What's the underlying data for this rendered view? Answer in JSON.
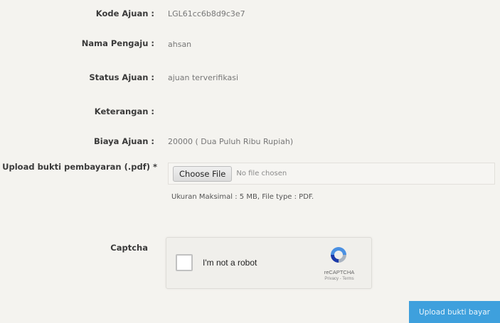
{
  "form": {
    "kode_label": "Kode Ajuan :",
    "kode_value": "LGL61cc6b8d9c3e7",
    "nama_label": "Nama Pengaju :",
    "nama_value": "ahsan",
    "status_label": "Status Ajuan :",
    "status_value": "ajuan terverifikasi",
    "keterangan_label": "Keterangan :",
    "keterangan_value": "",
    "biaya_label": "Biaya Ajuan :",
    "biaya_value": "20000 ( Dua Puluh Ribu Rupiah)",
    "upload_label": "Upload bukti pembayaran (.pdf) *",
    "choose_file_label": "Choose File",
    "no_file_text": "No file chosen",
    "file_hint": "Ukuran Maksimal : 5 MB, File type : PDF.",
    "captcha_label": "Captcha",
    "submit_label": "Upload bukti bayar"
  },
  "recaptcha": {
    "checkbox_label": "I'm not a robot",
    "brand": "reCAPTCHA",
    "terms": "Privacy - Terms"
  },
  "colors": {
    "submit_button": "#3ea0dd",
    "background": "#f4f3ef"
  }
}
